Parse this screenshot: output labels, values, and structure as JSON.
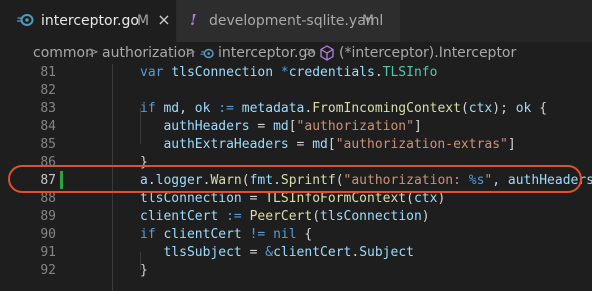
{
  "tabs": [
    {
      "label": "interceptor.go",
      "modified": "M",
      "close": "×",
      "icon": "go-file-icon"
    },
    {
      "label": "development-sqlite.yaml",
      "modified": "M",
      "icon": "yaml-file-icon",
      "icon_glyph": "!"
    }
  ],
  "breadcrumb": {
    "items": [
      "common",
      "authorization",
      "interceptor.go",
      "(*interceptor).Interceptor"
    ],
    "separator": ">"
  },
  "editor": {
    "line_numbers": [
      "81",
      "82",
      "83",
      "84",
      "85",
      "86",
      "87",
      "88",
      "89",
      "90",
      "91",
      "92"
    ],
    "current_line": "87",
    "lines": [
      [
        [
          "kw",
          "var"
        ],
        [
          "op",
          " "
        ],
        [
          "id",
          "tlsConnection"
        ],
        [
          "op",
          " "
        ],
        [
          "kw",
          "*"
        ],
        [
          "id",
          "credentials"
        ],
        [
          "op",
          "."
        ],
        [
          "ty",
          "TLSInfo"
        ]
      ],
      [],
      [
        [
          "kw",
          "if"
        ],
        [
          "op",
          " "
        ],
        [
          "id",
          "md"
        ],
        [
          "op",
          ", "
        ],
        [
          "id",
          "ok"
        ],
        [
          "op",
          " "
        ],
        [
          "kw",
          ":="
        ],
        [
          "op",
          " "
        ],
        [
          "id",
          "metadata"
        ],
        [
          "op",
          "."
        ],
        [
          "fn",
          "FromIncomingContext"
        ],
        [
          "op",
          "("
        ],
        [
          "id",
          "ctx"
        ],
        [
          "op",
          "); "
        ],
        [
          "id",
          "ok"
        ],
        [
          "op",
          " {"
        ]
      ],
      [
        [
          "op",
          "   "
        ],
        [
          "id",
          "authHeaders"
        ],
        [
          "op",
          " = "
        ],
        [
          "id",
          "md"
        ],
        [
          "op",
          "["
        ],
        [
          "st",
          "\"authorization\""
        ],
        [
          "op",
          "]"
        ]
      ],
      [
        [
          "op",
          "   "
        ],
        [
          "id",
          "authExtraHeaders"
        ],
        [
          "op",
          " = "
        ],
        [
          "id",
          "md"
        ],
        [
          "op",
          "["
        ],
        [
          "st",
          "\"authorization-extras\""
        ],
        [
          "op",
          "]"
        ]
      ],
      [
        [
          "op",
          "}"
        ]
      ],
      [
        [
          "id",
          "a"
        ],
        [
          "op",
          "."
        ],
        [
          "id",
          "logger"
        ],
        [
          "op",
          "."
        ],
        [
          "fn",
          "Warn"
        ],
        [
          "op",
          "("
        ],
        [
          "id",
          "fmt"
        ],
        [
          "op",
          "."
        ],
        [
          "fn",
          "Sprintf"
        ],
        [
          "op",
          "("
        ],
        [
          "st",
          "\"authorization: "
        ],
        [
          "kw",
          "%s"
        ],
        [
          "st",
          "\""
        ],
        [
          "op",
          ", "
        ],
        [
          "id",
          "authHeaders"
        ],
        [
          "op",
          "))"
        ]
      ],
      [
        [
          "id",
          "tlsConnection"
        ],
        [
          "op",
          " = "
        ],
        [
          "fn",
          "TLSInfoFormContext"
        ],
        [
          "op",
          "("
        ],
        [
          "id",
          "ctx"
        ],
        [
          "op",
          ")"
        ]
      ],
      [
        [
          "id",
          "clientCert"
        ],
        [
          "op",
          " "
        ],
        [
          "kw",
          ":="
        ],
        [
          "op",
          " "
        ],
        [
          "fn",
          "PeerCert"
        ],
        [
          "op",
          "("
        ],
        [
          "id",
          "tlsConnection"
        ],
        [
          "op",
          ")"
        ]
      ],
      [
        [
          "kw",
          "if"
        ],
        [
          "op",
          " "
        ],
        [
          "id",
          "clientCert"
        ],
        [
          "op",
          " "
        ],
        [
          "kw",
          "!="
        ],
        [
          "op",
          " "
        ],
        [
          "kw",
          "nil"
        ],
        [
          "op",
          " {"
        ]
      ],
      [
        [
          "op",
          "   "
        ],
        [
          "id",
          "tlsSubject"
        ],
        [
          "op",
          " = "
        ],
        [
          "kw",
          "&"
        ],
        [
          "id",
          "clientCert"
        ],
        [
          "op",
          "."
        ],
        [
          "id",
          "Subject"
        ]
      ],
      [
        [
          "op",
          "}"
        ]
      ]
    ]
  },
  "colors": {
    "background": "#1e1e1e",
    "tab_bar": "#252526",
    "keyword": "#569cd6",
    "type": "#4ec9b0",
    "function": "#dcdcaa",
    "string": "#ce9178",
    "identifier": "#9cdcfe",
    "git_modified": "#2ea043",
    "highlight_ring": "#e0502a"
  }
}
